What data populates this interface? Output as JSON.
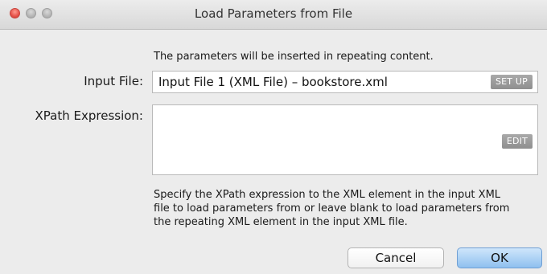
{
  "window": {
    "title": "Load Parameters from File"
  },
  "dialog": {
    "info_text": "The parameters will be inserted in repeating content.",
    "input_file": {
      "label": "Input File:",
      "value": "Input File 1 (XML File) – bookstore.xml",
      "setup_label": "SET UP"
    },
    "xpath": {
      "label": "XPath Expression:",
      "value": "",
      "edit_label": "EDIT"
    },
    "help_lines": [
      "Specify the XPath expression to the XML element in the input XML",
      "file to load parameters from or leave blank to load parameters from",
      "the repeating XML element in the input XML file."
    ],
    "buttons": {
      "cancel": "Cancel",
      "ok": "OK"
    }
  },
  "colors": {
    "window_bg": "#ececec",
    "ok_button": "#8fc0ef",
    "mini_button": "#999999"
  }
}
